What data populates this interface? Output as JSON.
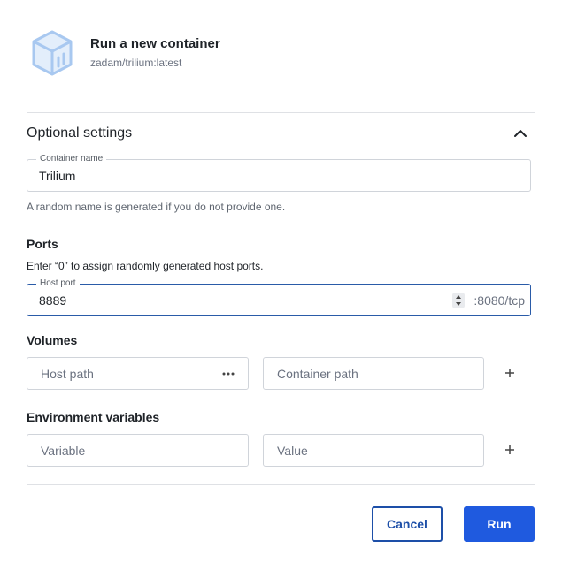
{
  "header": {
    "title": "Run a new container",
    "image": "zadam/trilium:latest",
    "icon": "container-box-icon",
    "icon_color": "#a8c8f0"
  },
  "optional_settings": {
    "title": "Optional settings",
    "expanded": true,
    "toggle_icon": "chevron-up-icon"
  },
  "container_name": {
    "label": "Container name",
    "value": "Trilium",
    "helper": "A random name is generated if you do not provide one."
  },
  "ports": {
    "title": "Ports",
    "helper": "Enter “0” to assign randomly generated host ports.",
    "host_port_label": "Host port",
    "host_port_value": "8889",
    "container_port": ":8080/tcp"
  },
  "volumes": {
    "title": "Volumes",
    "host_path_placeholder": "Host path",
    "container_path_placeholder": "Container path",
    "browse_icon": "more-horizontal-icon",
    "add_icon": "plus-icon"
  },
  "env": {
    "title": "Environment variables",
    "variable_placeholder": "Variable",
    "value_placeholder": "Value",
    "add_icon": "plus-icon"
  },
  "actions": {
    "cancel_label": "Cancel",
    "run_label": "Run",
    "primary_color": "#1f5adf"
  }
}
